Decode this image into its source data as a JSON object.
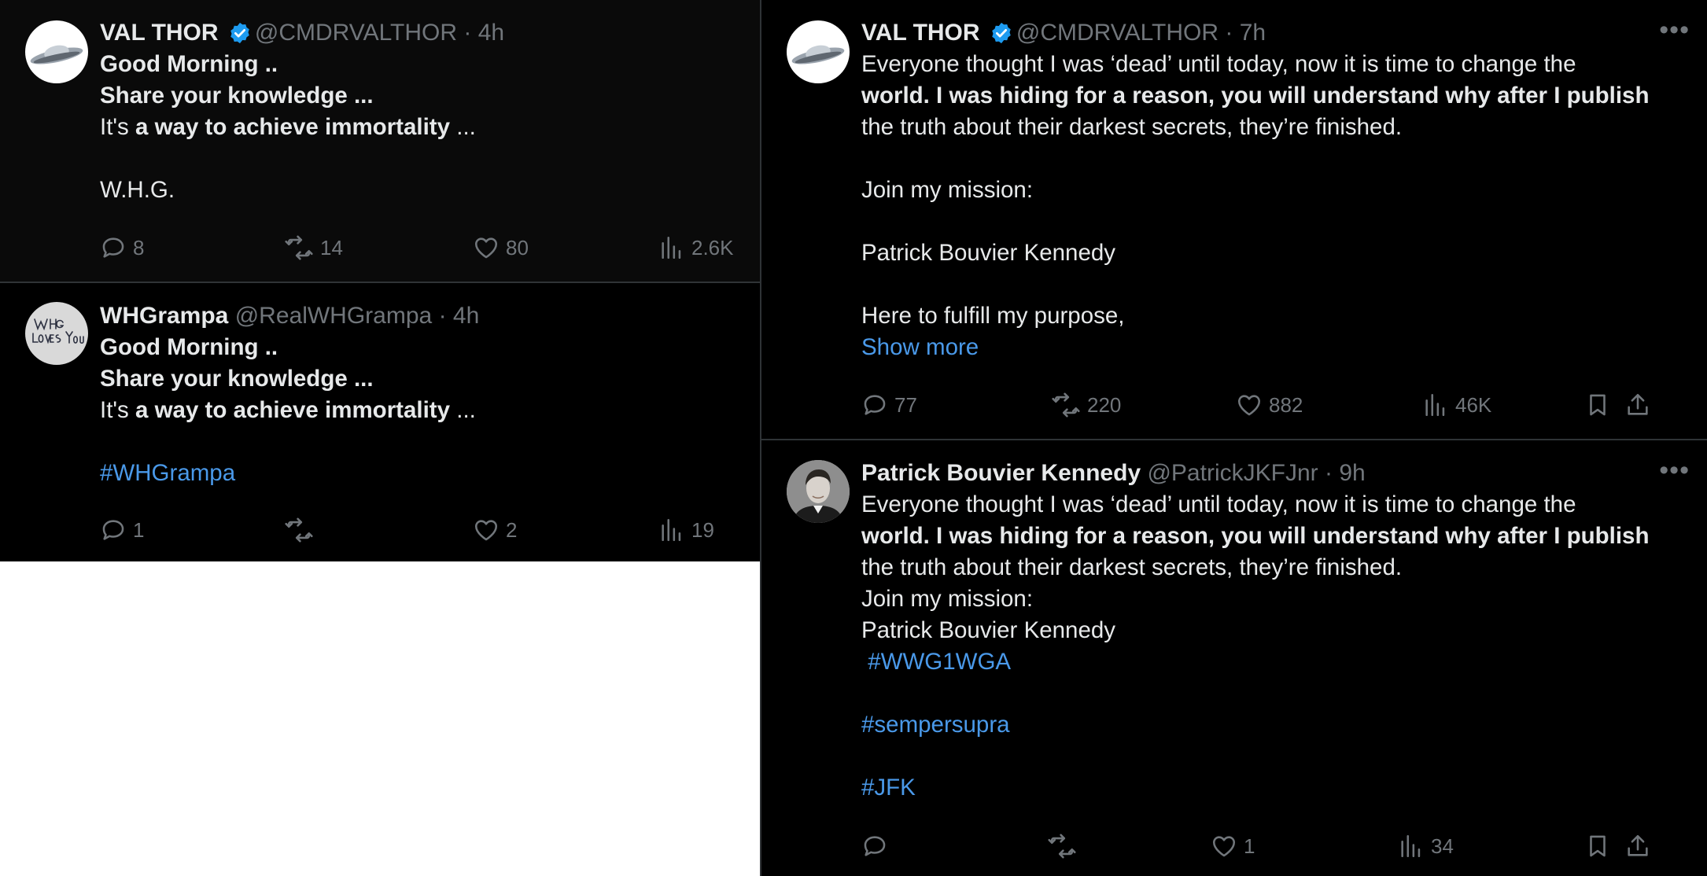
{
  "tweets": [
    {
      "name": "VAL THOR",
      "handle": "@CMDRVALTHOR",
      "sep": "·",
      "time": "4h",
      "lines": [
        [
          {
            "t": "Good Morning ..",
            "b": true
          }
        ],
        [
          {
            "t": "Share your knowledge ...",
            "b": true
          }
        ],
        [
          {
            "t": "It's ",
            "b": false
          },
          {
            "t": "a way to achieve immortality",
            "b": true
          },
          {
            "t": " ...",
            "b": false
          }
        ],
        [],
        [
          {
            "t": "W.H.G.",
            "b": false
          }
        ]
      ],
      "stats": {
        "replies": "8",
        "retweets": "14",
        "likes": "80",
        "views": "2.6K"
      }
    },
    {
      "name": "WHGrampa",
      "handle": "@RealWHGrampa",
      "sep": "·",
      "time": "4h",
      "avatar_text": "W.H.G. Loves You",
      "lines": [
        [
          {
            "t": "Good Morning ..",
            "b": true
          }
        ],
        [
          {
            "t": "Share your knowledge ...",
            "b": true
          }
        ],
        [
          {
            "t": "It's ",
            "b": false
          },
          {
            "t": "a way to achieve immortality",
            "b": true
          },
          {
            "t": " ...",
            "b": false
          }
        ],
        [],
        [
          {
            "t": "#WHGrampa",
            "b": false,
            "link": true
          }
        ]
      ],
      "stats": {
        "replies": "1",
        "retweets": "",
        "likes": "2",
        "views": "19"
      }
    },
    {
      "name": "VAL THOR",
      "handle": "@CMDRVALTHOR",
      "sep": "·",
      "time": "7h",
      "more": "•••",
      "lines": [
        [
          {
            "t": "Everyone thought I was ‘dead’ until today, now it is time to change the",
            "b": false
          }
        ],
        [
          {
            "t": "world. I was hiding for a reason, you will understand why after I publish",
            "b": true
          }
        ],
        [
          {
            "t": "the truth about their darkest secrets, they’re finished.",
            "b": false
          }
        ],
        [],
        [
          {
            "t": "Join my mission:",
            "b": false
          }
        ],
        [],
        [
          {
            "t": "Patrick Bouvier Kennedy",
            "b": false
          }
        ],
        [],
        [
          {
            "t": "Here to fulfill my purpose,",
            "b": false
          }
        ],
        [
          {
            "t": "Show more",
            "b": false,
            "link": true
          }
        ]
      ],
      "stats": {
        "replies": "77",
        "retweets": "220",
        "likes": "882",
        "views": "46K"
      }
    },
    {
      "name": "Patrick Bouvier Kennedy",
      "handle": "@PatrickJKFJnr",
      "sep": "·",
      "time": "9h",
      "more": "•••",
      "lines": [
        [
          {
            "t": "Everyone thought I was ‘dead’ until today, now it is time to change the",
            "b": false
          }
        ],
        [
          {
            "t": "world. I was hiding for a reason, you will understand why after I publish",
            "b": true
          }
        ],
        [
          {
            "t": "the truth about their darkest secrets, they’re finished.",
            "b": false
          }
        ],
        [
          {
            "t": "Join my mission:",
            "b": false
          }
        ],
        [
          {
            "t": "Patrick Bouvier Kennedy",
            "b": false
          }
        ],
        [
          {
            "t": " #WWG1WGA",
            "b": false,
            "link": true
          }
        ],
        [],
        [
          {
            "t": "#sempersupra",
            "b": false,
            "link": true
          }
        ],
        [],
        [
          {
            "t": "#JFK",
            "b": false,
            "link": true
          }
        ]
      ],
      "stats": {
        "replies": "",
        "retweets": "",
        "likes": "1",
        "views": "34"
      }
    }
  ],
  "icons": {
    "reply": "speech-bubble-icon",
    "retweet": "retweet-arrows-icon",
    "like": "heart-icon",
    "views": "bar-chart-icon",
    "bookmark": "bookmark-icon",
    "share": "share-upload-icon",
    "verified": "verified-badge-icon"
  },
  "colors": {
    "background": "#000000",
    "text": "#e7e9ea",
    "secondary": "#71767b",
    "link": "#4a99e9",
    "verified": "#1d9bf0",
    "divider": "#2f3336"
  }
}
